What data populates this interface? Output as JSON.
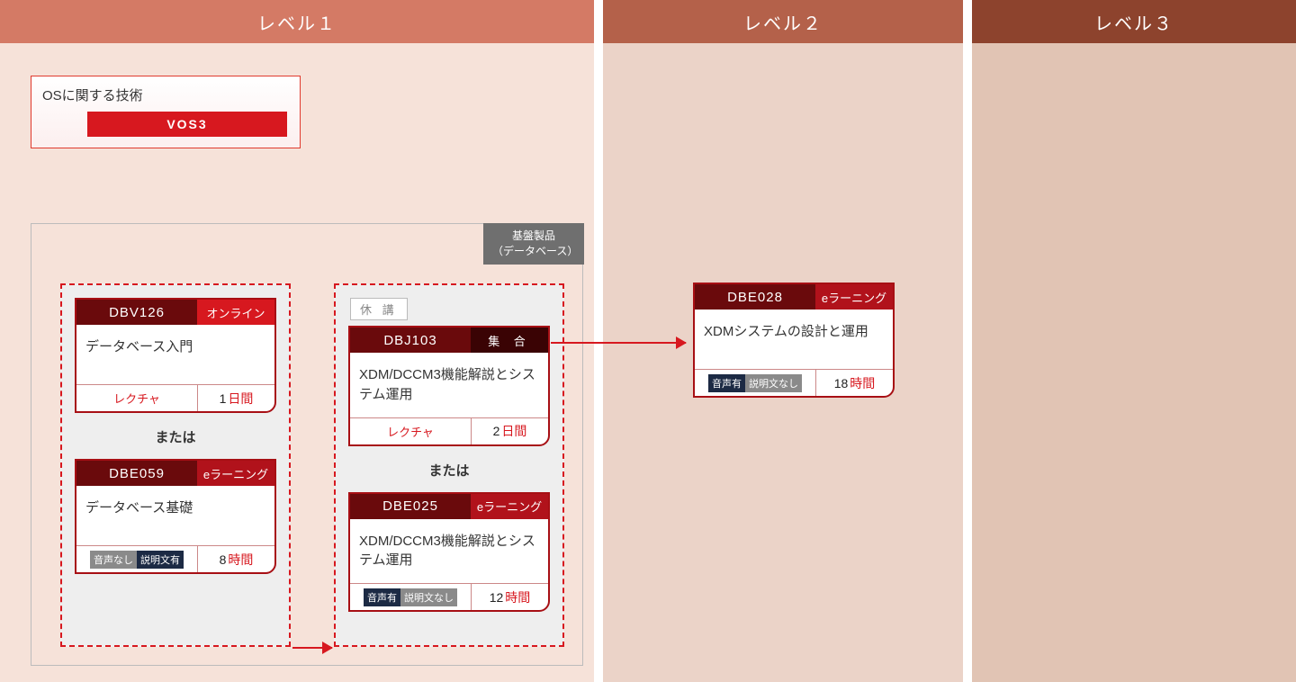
{
  "levels": {
    "l1": "レベル１",
    "l2": "レベル２",
    "l3": "レベル３"
  },
  "context": {
    "title": "OSに関する技術",
    "tag": "VOS3"
  },
  "region": {
    "label_line1": "基盤製品",
    "label_line2": "（データベース）"
  },
  "status": {
    "closed": "休 講"
  },
  "or_label": "または",
  "cards": {
    "dbv126": {
      "code": "DBV126",
      "mode": "オンライン",
      "title": "データベース入門",
      "foot_left_type": "lecture",
      "foot_left": "レクチャ",
      "dur_num": "1",
      "dur_unit": "日間"
    },
    "dbe059": {
      "code": "DBE059",
      "mode": "eラーニング",
      "title": "データベース基礎",
      "foot_left_type": "badges",
      "badge1": "音声なし",
      "badge2": "説明文有",
      "dur_num": "8",
      "dur_unit": "時間"
    },
    "dbj103": {
      "code": "DBJ103",
      "mode": "集 合",
      "title": "XDM/DCCM3機能解説とシステム運用",
      "foot_left_type": "lecture",
      "foot_left": "レクチャ",
      "dur_num": "2",
      "dur_unit": "日間"
    },
    "dbe025": {
      "code": "DBE025",
      "mode": "eラーニング",
      "title": "XDM/DCCM3機能解説とシステム運用",
      "foot_left_type": "badges",
      "badge1": "音声有",
      "badge2": "説明文なし",
      "dur_num": "12",
      "dur_unit": "時間"
    },
    "dbe028": {
      "code": "DBE028",
      "mode": "eラーニング",
      "title": "XDMシステムの設計と運用",
      "foot_left_type": "badges",
      "badge1": "音声有",
      "badge2": "説明文なし",
      "dur_num": "18",
      "dur_unit": "時間"
    }
  }
}
